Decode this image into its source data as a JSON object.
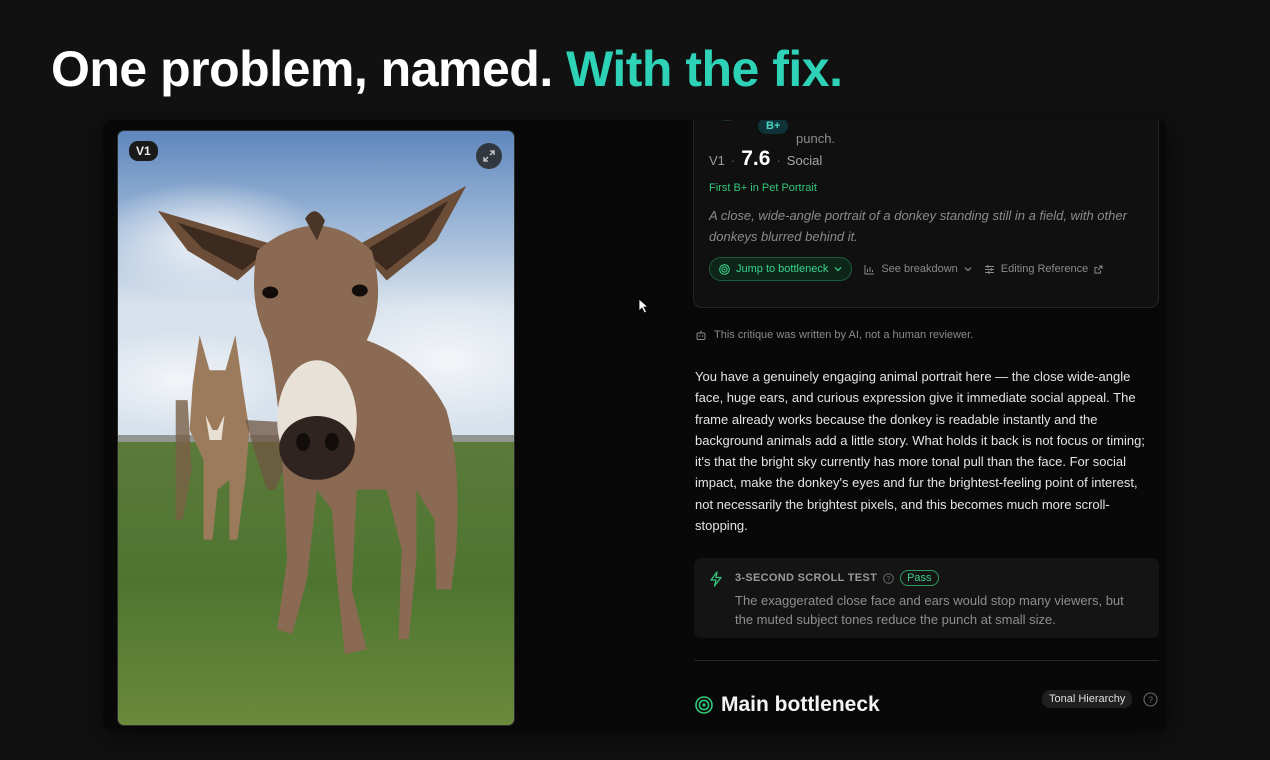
{
  "headline": {
    "part1": "One problem, named.",
    "part2": "With the fix."
  },
  "colors": {
    "accent": "#2ed3b7",
    "green": "#34c77b",
    "background": "#111111"
  },
  "photo": {
    "version_badge": "V1",
    "expand_icon": "expand-icon"
  },
  "card": {
    "grade": "B+",
    "peek_text": "punch.",
    "version": "V1",
    "score": "7.6",
    "category": "Social",
    "achievement": "First B+ in Pet Portrait",
    "description": "A close, wide-angle portrait of a donkey standing still in a field, with other donkeys blurred behind it.",
    "actions": {
      "jump": "Jump to bottleneck",
      "breakdown": "See breakdown",
      "reference": "Editing Reference"
    }
  },
  "ai_note": "This critique was written by AI, not a human reviewer.",
  "critique": "You have a genuinely engaging animal portrait here — the close wide-angle face, huge ears, and curious expression give it immediate social appeal. The frame already works because the donkey is readable instantly and the background animals add a little story. What holds it back is not focus or timing; it's that the bright sky currently has more tonal pull than the face. For social impact, make the donkey's eyes and fur the brightest-feeling point of interest, not necessarily the brightest pixels, and this becomes much more scroll-stopping.",
  "scroll_test": {
    "label": "3-SECOND SCROLL TEST",
    "status": "Pass",
    "text": "The exaggerated close face and ears would stop many viewers, but the muted subject tones reduce the punch at small size."
  },
  "bottleneck": {
    "title": "Main bottleneck",
    "tag": "Tonal Hierarchy"
  }
}
